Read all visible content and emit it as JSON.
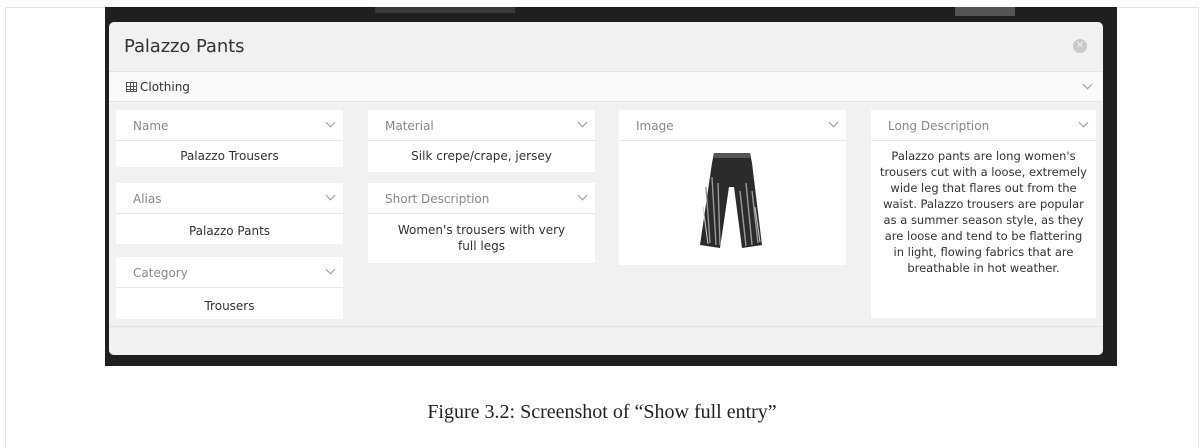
{
  "modal": {
    "title": "Palazzo Pants",
    "close_icon": "close-circle-icon",
    "category": {
      "label": "Clothing",
      "icon": "table-icon"
    }
  },
  "fields": {
    "name": {
      "label": "Name",
      "value": "Palazzo Trousers"
    },
    "alias": {
      "label": "Alias",
      "value": "Palazzo Pants"
    },
    "category": {
      "label": "Category",
      "value": "Trousers"
    },
    "material": {
      "label": "Material",
      "value": "Silk crepe/crape, jersey"
    },
    "short_description": {
      "label": "Short Description",
      "value": "Women's trousers with very full legs"
    },
    "image": {
      "label": "Image",
      "alt": "palazzo-pants-sketch"
    },
    "long_description": {
      "label": "Long Description",
      "value": "Palazzo pants are long women's trousers cut with a loose, extremely wide leg that flares out from the waist. Palazzo trousers are popular as a summer season style, as they are loose and tend to be flattering in light, flowing fabrics that are breathable in hot weather."
    }
  },
  "caption": "Figure 3.2: Screenshot of “Show full entry”"
}
